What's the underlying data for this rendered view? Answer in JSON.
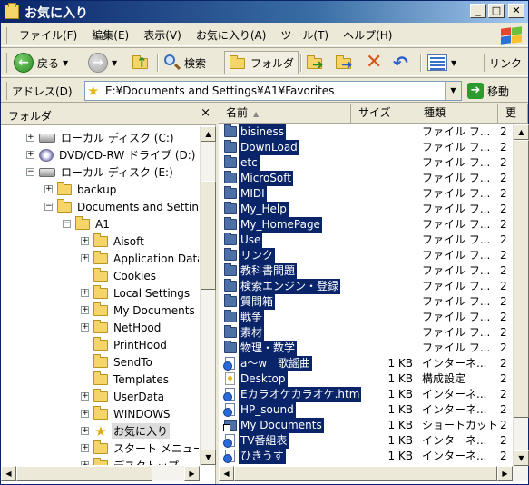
{
  "window": {
    "title": "お気に入り",
    "minimize": "_",
    "maximize": "□",
    "close": "✕"
  },
  "menu": [
    "ファイル(F)",
    "編集(E)",
    "表示(V)",
    "お気に入り(A)",
    "ツール(T)",
    "ヘルプ(H)"
  ],
  "toolbar": {
    "back": "戻る",
    "search": "検索",
    "folders": "フォルダ",
    "links": "リンク"
  },
  "address": {
    "label": "アドレス(D)",
    "value": "E:¥Documents and Settings¥A1¥Favorites",
    "go": "移動"
  },
  "folder_pane": {
    "title": "フォルダ",
    "close": "×",
    "items": [
      {
        "label": "ローカル ディスク (C:)",
        "expander": "+",
        "icon": "drive-icon"
      },
      {
        "label": "DVD/CD-RW ドライブ (D:)",
        "expander": "+",
        "icon": "cd-drive-icon"
      },
      {
        "label": "ローカル ディスク (E:)",
        "expander": "−",
        "icon": "drive-icon"
      },
      {
        "label": "backup",
        "expander": "+",
        "icon": "folder-icon"
      },
      {
        "label": "Documents and Settings",
        "expander": "−",
        "icon": "folder-icon"
      },
      {
        "label": "A1",
        "expander": "−",
        "icon": "folder-icon"
      },
      {
        "label": "Aisoft",
        "expander": "+",
        "icon": "folder-icon"
      },
      {
        "label": "Application Data",
        "expander": "+",
        "icon": "folder-icon"
      },
      {
        "label": "Cookies",
        "expander": "",
        "icon": "folder-icon"
      },
      {
        "label": "Local Settings",
        "expander": "+",
        "icon": "folder-icon"
      },
      {
        "label": "My Documents",
        "expander": "+",
        "icon": "folder-icon"
      },
      {
        "label": "NetHood",
        "expander": "+",
        "icon": "folder-icon"
      },
      {
        "label": "PrintHood",
        "expander": "",
        "icon": "folder-icon"
      },
      {
        "label": "SendTo",
        "expander": "",
        "icon": "folder-icon"
      },
      {
        "label": "Templates",
        "expander": "",
        "icon": "folder-icon"
      },
      {
        "label": "UserData",
        "expander": "+",
        "icon": "folder-icon"
      },
      {
        "label": "WINDOWS",
        "expander": "+",
        "icon": "folder-icon"
      },
      {
        "label": "お気に入り",
        "expander": "+",
        "icon": "star-icon"
      },
      {
        "label": "スタート メニュー",
        "expander": "+",
        "icon": "folder-icon"
      },
      {
        "label": "デスクトップ",
        "expander": "+",
        "icon": "folder-icon"
      }
    ]
  },
  "file_list": {
    "columns": [
      "名前",
      "サイズ",
      "種類",
      "更"
    ],
    "rows": [
      {
        "name": "bisiness",
        "size": "",
        "type": "ファイル フ...",
        "date": "2",
        "icon": "folder"
      },
      {
        "name": "DownLoad",
        "size": "",
        "type": "ファイル フ...",
        "date": "2",
        "icon": "folder"
      },
      {
        "name": "etc",
        "size": "",
        "type": "ファイル フ...",
        "date": "2",
        "icon": "folder"
      },
      {
        "name": "MicroSoft",
        "size": "",
        "type": "ファイル フ...",
        "date": "2",
        "icon": "folder"
      },
      {
        "name": "MIDI",
        "size": "",
        "type": "ファイル フ...",
        "date": "2",
        "icon": "folder"
      },
      {
        "name": "My_Help",
        "size": "",
        "type": "ファイル フ...",
        "date": "2",
        "icon": "folder"
      },
      {
        "name": "My_HomePage",
        "size": "",
        "type": "ファイル フ...",
        "date": "2",
        "icon": "folder"
      },
      {
        "name": "Use",
        "size": "",
        "type": "ファイル フ...",
        "date": "2",
        "icon": "folder"
      },
      {
        "name": "リンク",
        "size": "",
        "type": "ファイル フ...",
        "date": "2",
        "icon": "folder"
      },
      {
        "name": "教科書問題",
        "size": "",
        "type": "ファイル フ...",
        "date": "2",
        "icon": "folder"
      },
      {
        "name": "検索エンジン・登録",
        "size": "",
        "type": "ファイル フ...",
        "date": "2",
        "icon": "folder"
      },
      {
        "name": "質問箱",
        "size": "",
        "type": "ファイル フ...",
        "date": "2",
        "icon": "folder"
      },
      {
        "name": "戦争",
        "size": "",
        "type": "ファイル フ...",
        "date": "2",
        "icon": "folder"
      },
      {
        "name": "素材",
        "size": "",
        "type": "ファイル フ...",
        "date": "2",
        "icon": "folder"
      },
      {
        "name": "物理・数学",
        "size": "",
        "type": "ファイル フ...",
        "date": "2",
        "icon": "folder"
      },
      {
        "name": "a～w　歌謡曲",
        "size": "1 KB",
        "type": "インターネ...",
        "date": "2",
        "icon": "url"
      },
      {
        "name": "Desktop",
        "size": "1 KB",
        "type": "構成設定",
        "date": "2",
        "icon": "ini"
      },
      {
        "name": "Eカラオケカラオケ.htm",
        "size": "1 KB",
        "type": "インターネ...",
        "date": "2",
        "icon": "url"
      },
      {
        "name": "HP_sound",
        "size": "1 KB",
        "type": "インターネ...",
        "date": "2",
        "icon": "url"
      },
      {
        "name": "My Documents",
        "size": "1 KB",
        "type": "ショートカット",
        "date": "2",
        "icon": "lnk"
      },
      {
        "name": "TV番組表",
        "size": "1 KB",
        "type": "インターネ...",
        "date": "2",
        "icon": "url"
      },
      {
        "name": "ひきうす",
        "size": "1 KB",
        "type": "インターネ...",
        "date": "2",
        "icon": "url"
      }
    ]
  }
}
